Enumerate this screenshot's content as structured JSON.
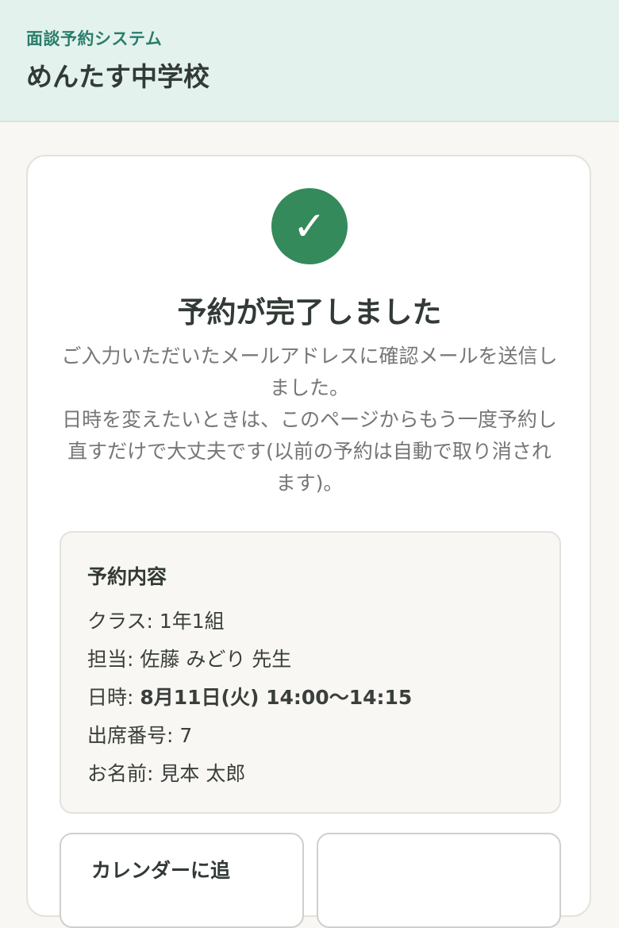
{
  "header": {
    "system_name": "面談予約システム",
    "school_name": "めんたす中学校"
  },
  "completion": {
    "check_glyph": "✓",
    "title": "予約が完了しました",
    "message_line1": "ご入力いただいたメールアドレスに確認メールを送信しました。",
    "message_line2": "日時を変えたいときは、このページからもう一度予約し直すだけで大丈夫です(以前の予約は自動で取り消されます)。"
  },
  "summary": {
    "title": "予約内容",
    "class_label": "クラス: ",
    "class_value": "1年1組",
    "teacher_label": "担当: ",
    "teacher_value": "佐藤 みどり 先生",
    "datetime_label": "日時: ",
    "datetime_value": "8月11日(火) 14:00〜14:15",
    "seat_label": "出席番号: ",
    "seat_value": "7",
    "name_label": "お名前: ",
    "name_value": "見本 太郎"
  },
  "actions": {
    "left_button_label": "カレンダーに追",
    "right_button_label": ""
  },
  "colors": {
    "header_bg": "#e4f2ee",
    "accent": "#2a7d6b",
    "check_bg": "#348a5a"
  }
}
